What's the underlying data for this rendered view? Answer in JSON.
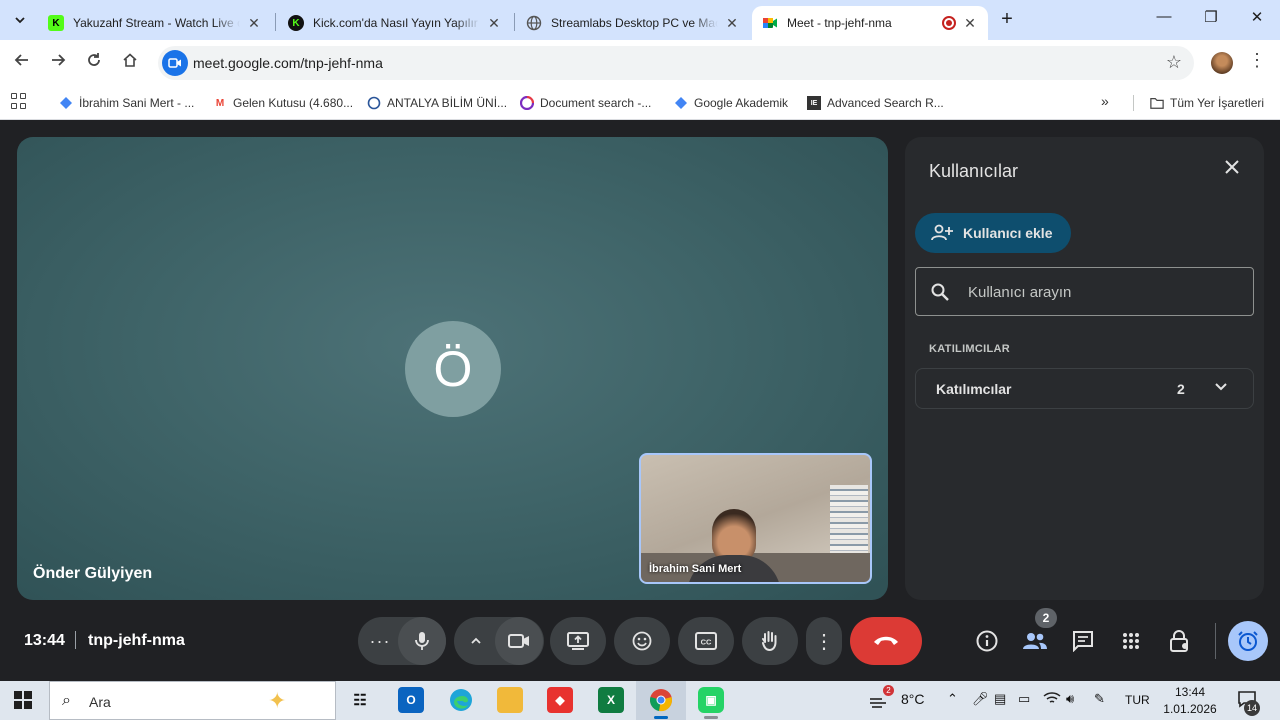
{
  "browser": {
    "tabs": [
      {
        "title": "Yakuzahf Stream - Watch Live o",
        "favicon": "kick-logo-icon"
      },
      {
        "title": "Kick.com'da Nasıl Yayın Yapılır |",
        "favicon": "kick-logo-icon"
      },
      {
        "title": "Streamlabs Desktop PC ve Mac",
        "favicon": "globe-icon"
      },
      {
        "title": "Meet - tnp-jehf-nma",
        "favicon": "meet-icon",
        "active": true
      }
    ],
    "url": "meet.google.com/tnp-jehf-nma",
    "bookmarks": [
      "İbrahim Sani Mert - ...",
      "Gelen Kutusu (4.680...",
      "ANTALYA BİLİM ÜNİ...",
      "Document search -...",
      "Google Akademik",
      "Advanced Search R..."
    ],
    "bookmarks_folder": "Tüm Yer İşaretleri"
  },
  "meet": {
    "main_tile": {
      "initial": "Ö",
      "name": "Önder Gülyiyen"
    },
    "self_tile": {
      "name": "İbrahim Sani Mert"
    },
    "time": "13:44",
    "meeting_code": "tnp-jehf-nma",
    "people_count": "2"
  },
  "panel": {
    "title": "Kullanıcılar",
    "add_label": "Kullanıcı ekle",
    "search_placeholder": "Kullanıcı arayın",
    "section_label": "KATILIMCILAR",
    "group_label": "Katılımcılar",
    "group_count": "2"
  },
  "taskbar": {
    "search_placeholder": "Ara",
    "weather": "8°C",
    "weather_badge": "2",
    "language": "TUR",
    "clock_time": "13:44",
    "clock_date": "1.01.2026",
    "notifications": "14"
  },
  "colors": {
    "tabstrip": "#d3e3fd",
    "meet_bg": "#202124",
    "hangup": "#dc3a35",
    "panel_bg": "#282a2d",
    "add_button": "#0e4e6e",
    "accent_blue": "#a8c7fa"
  }
}
